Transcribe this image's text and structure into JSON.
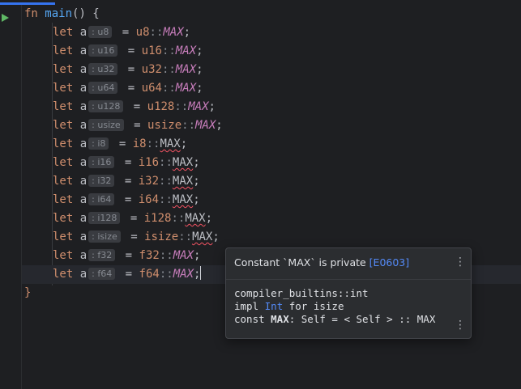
{
  "editor": {
    "header": {
      "kw": "fn",
      "name": "main",
      "open": "() {"
    },
    "lines": [
      {
        "kw": "let",
        "var": "a",
        "hint": ": u8",
        "eq": " = ",
        "ty": "u8",
        "sep": "::",
        "const": "MAX",
        "err": false
      },
      {
        "kw": "let",
        "var": "a",
        "hint": ": u16",
        "eq": " = ",
        "ty": "u16",
        "sep": "::",
        "const": "MAX",
        "err": false
      },
      {
        "kw": "let",
        "var": "a",
        "hint": ": u32",
        "eq": " = ",
        "ty": "u32",
        "sep": "::",
        "const": "MAX",
        "err": false
      },
      {
        "kw": "let",
        "var": "a",
        "hint": ": u64",
        "eq": " = ",
        "ty": "u64",
        "sep": "::",
        "const": "MAX",
        "err": false
      },
      {
        "kw": "let",
        "var": "a",
        "hint": ": u128",
        "eq": " = ",
        "ty": "u128",
        "sep": "::",
        "const": "MAX",
        "err": false
      },
      {
        "kw": "let",
        "var": "a",
        "hint": ": usize",
        "eq": " = ",
        "ty": "usize",
        "sep": "::",
        "const": "MAX",
        "err": false
      },
      {
        "kw": "let",
        "var": "a",
        "hint": ": i8",
        "eq": " = ",
        "ty": "i8",
        "sep": "::",
        "const": "MAX",
        "err": true
      },
      {
        "kw": "let",
        "var": "a",
        "hint": ": i16",
        "eq": " = ",
        "ty": "i16",
        "sep": "::",
        "const": "MAX",
        "err": true
      },
      {
        "kw": "let",
        "var": "a",
        "hint": ": i32",
        "eq": " = ",
        "ty": "i32",
        "sep": "::",
        "const": "MAX",
        "err": true
      },
      {
        "kw": "let",
        "var": "a",
        "hint": ": i64",
        "eq": " = ",
        "ty": "i64",
        "sep": "::",
        "const": "MAX",
        "err": true
      },
      {
        "kw": "let",
        "var": "a",
        "hint": ": i128",
        "eq": " = ",
        "ty": "i128",
        "sep": "::",
        "const": "MAX",
        "err": true
      },
      {
        "kw": "let",
        "var": "a",
        "hint": ": isize",
        "eq": " = ",
        "ty": "isize",
        "sep": "::",
        "const": "MAX",
        "err": true
      },
      {
        "kw": "let",
        "var": "a",
        "hint": ": f32",
        "eq": " = ",
        "ty": "f32",
        "sep": "::",
        "const": "MAX",
        "err": false
      },
      {
        "kw": "let",
        "var": "a",
        "hint": ": f64",
        "eq": " = ",
        "ty": "f64",
        "sep": "::",
        "const": "MAX",
        "err": false
      }
    ],
    "semicolon": ";",
    "close_brace": "}",
    "current_line": 13
  },
  "popup": {
    "title_prefix": "Constant `MAX` is private ",
    "error_code": "[E0603]",
    "doc_line1": "compiler_builtins::int",
    "doc_line2_kw": "impl ",
    "doc_line2_ty": "Int",
    "doc_line2_rest": " for isize",
    "doc_line3_kw": "const ",
    "doc_line3_name": "MAX",
    "doc_line3_rest": ": Self = < Self > :: MAX",
    "more_icon": "⋮"
  },
  "icons": {
    "run": "run-triangle-icon",
    "more": "more-vertical-icon"
  },
  "colors": {
    "keyword": "#cf8e6d",
    "function": "#56a8f5",
    "constant": "#c77dbb",
    "error_underline": "#f75464",
    "link": "#548af7",
    "run": "#5fb865"
  }
}
